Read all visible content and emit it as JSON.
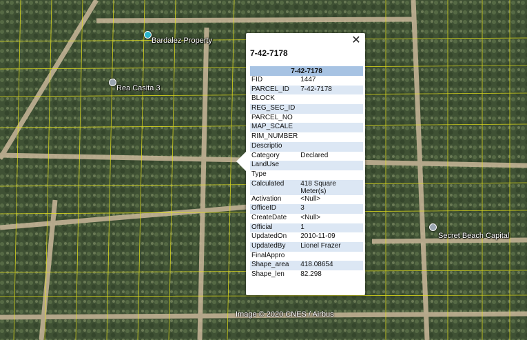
{
  "map": {
    "places": [
      {
        "name": "Bardalez Property",
        "pin_color": "#2bb3c9"
      },
      {
        "name": "Rea Casita 3",
        "pin_color": "#9aa5b1"
      },
      {
        "name": "Secret Beach Capital",
        "pin_color": "#9aa5b1"
      }
    ],
    "attribution": "Image © 2020 CNES / Airbus",
    "parcel_line_color": "#e6e21a"
  },
  "popup": {
    "close_glyph": "✕",
    "title": "7-42-7178",
    "table_header": "7-42-7178",
    "rows": [
      {
        "key": "FID",
        "value": "1447"
      },
      {
        "key": "PARCEL_ID",
        "value": "7-42-7178"
      },
      {
        "key": "BLOCK",
        "value": ""
      },
      {
        "key": "REG_SEC_ID",
        "value": ""
      },
      {
        "key": "PARCEL_NO",
        "value": ""
      },
      {
        "key": "MAP_SCALE",
        "value": ""
      },
      {
        "key": "RIM_NUMBER",
        "value": ""
      },
      {
        "key": "Descriptio",
        "value": ""
      },
      {
        "key": "Category",
        "value": "Declared"
      },
      {
        "key": "LandUse",
        "value": ""
      },
      {
        "key": "Type",
        "value": ""
      },
      {
        "key": "Calculated",
        "value": "418 Square Meter(s)"
      },
      {
        "key": "Activation",
        "value": "<Null>"
      },
      {
        "key": "OfficeID",
        "value": "3"
      },
      {
        "key": "CreateDate",
        "value": "<Null>"
      },
      {
        "key": "Official",
        "value": "1"
      },
      {
        "key": "UpdatedOn",
        "value": "2010-11-09"
      },
      {
        "key": "UpdatedBy",
        "value": "Lionel Frazer"
      },
      {
        "key": "FinalAppro",
        "value": ""
      },
      {
        "key": "Shape_area",
        "value": "418.08654"
      },
      {
        "key": "Shape_len",
        "value": "82.298"
      }
    ]
  }
}
